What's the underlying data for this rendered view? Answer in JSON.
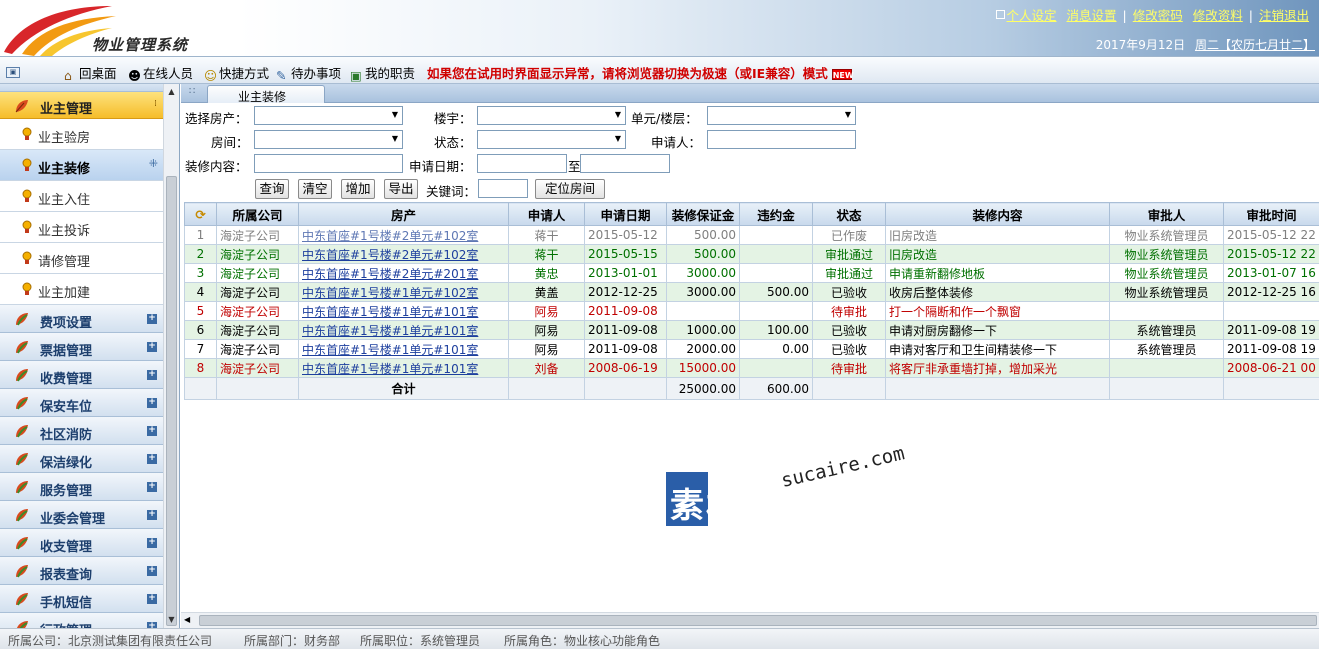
{
  "header": {
    "logo_text": "物业管理系统",
    "links": [
      "个人设定",
      "消息设置",
      "修改密码",
      "修改资料",
      "注销退出"
    ],
    "date": "2017年9月12日",
    "weekday_lunar": "周二【农历七月廿二】"
  },
  "toolbar": {
    "items": [
      "回桌面",
      "在线人员",
      "快捷方式",
      "待办事项",
      "我的职责"
    ],
    "warning": "如果您在试用时界面显示异常，请将浏览器切换为极速（或IE兼容）模式"
  },
  "sidebar": {
    "active_group": "业主管理",
    "sub_items": [
      "业主验房",
      "业主装修",
      "业主入住",
      "业主投诉",
      "请修管理",
      "业主加建"
    ],
    "active_sub": "业主装修",
    "menus": [
      "费项设置",
      "票据管理",
      "收费管理",
      "保安车位",
      "社区消防",
      "保洁绿化",
      "服务管理",
      "业委会管理",
      "收支管理",
      "报表查询",
      "手机短信",
      "行政管理"
    ]
  },
  "tab": {
    "title": "业主装修"
  },
  "filters": {
    "house_label": "选择房产：",
    "building_label": "楼宇：",
    "unit_floor_label": "单元/楼层：",
    "room_label": "房间：",
    "status_label": "状态：",
    "applicant_label": "申请人：",
    "content_label": "装修内容：",
    "date_label": "申请日期：",
    "date_to": "至",
    "keyword_label": "关键词："
  },
  "buttons": {
    "query": "查询",
    "clear": "清空",
    "add": "增加",
    "export": "导出",
    "locate": "定位房间"
  },
  "table": {
    "columns": [
      "所属公司",
      "房产",
      "申请人",
      "申请日期",
      "装修保证金",
      "违约金",
      "状态",
      "装修内容",
      "审批人",
      "审批时间"
    ],
    "rows": [
      {
        "no": "1",
        "company": "海淀子公司",
        "property": "中东首座#1号楼#2单元#102室",
        "applicant": "蒋干",
        "date": "2015-05-12",
        "deposit": "500.00",
        "penalty": "",
        "status": "已作废",
        "content": "旧房改造",
        "approver": "物业系统管理员",
        "approve_time": "2015-05-12 22",
        "tone": "s-gray"
      },
      {
        "no": "2",
        "company": "海淀子公司",
        "property": "中东首座#1号楼#2单元#102室",
        "applicant": "蒋干",
        "date": "2015-05-15",
        "deposit": "500.00",
        "penalty": "",
        "status": "审批通过",
        "content": "旧房改造",
        "approver": "物业系统管理员",
        "approve_time": "2015-05-12 22",
        "tone": "s-green"
      },
      {
        "no": "3",
        "company": "海淀子公司",
        "property": "中东首座#1号楼#2单元#201室",
        "applicant": "黄忠",
        "date": "2013-01-01",
        "deposit": "3000.00",
        "penalty": "",
        "status": "审批通过",
        "content": "申请重新翻修地板",
        "approver": "物业系统管理员",
        "approve_time": "2013-01-07 16",
        "tone": "s-green"
      },
      {
        "no": "4",
        "company": "海淀子公司",
        "property": "中东首座#1号楼#1单元#102室",
        "applicant": "黄盖",
        "date": "2012-12-25",
        "deposit": "3000.00",
        "penalty": "500.00",
        "status": "已验收",
        "content": "收房后整体装修",
        "approver": "物业系统管理员",
        "approve_time": "2012-12-25 16",
        "tone": "s-black"
      },
      {
        "no": "5",
        "company": "海淀子公司",
        "property": "中东首座#1号楼#1单元#101室",
        "applicant": "阿易",
        "date": "2011-09-08",
        "deposit": "",
        "penalty": "",
        "status": "待审批",
        "content": "打一个隔断和作一个飘窗",
        "approver": "",
        "approve_time": "",
        "tone": "s-red"
      },
      {
        "no": "6",
        "company": "海淀子公司",
        "property": "中东首座#1号楼#1单元#101室",
        "applicant": "阿易",
        "date": "2011-09-08",
        "deposit": "1000.00",
        "penalty": "100.00",
        "status": "已验收",
        "content": "申请对厨房翻修一下",
        "approver": "系统管理员",
        "approve_time": "2011-09-08 19",
        "tone": "s-black"
      },
      {
        "no": "7",
        "company": "海淀子公司",
        "property": "中东首座#1号楼#1单元#101室",
        "applicant": "阿易",
        "date": "2011-09-08",
        "deposit": "2000.00",
        "penalty": "0.00",
        "status": "已验收",
        "content": "申请对客厅和卫生间精装修一下",
        "approver": "系统管理员",
        "approve_time": "2011-09-08 19",
        "tone": "s-black"
      },
      {
        "no": "8",
        "company": "海淀子公司",
        "property": "中东首座#1号楼#1单元#101室",
        "applicant": "刘备",
        "date": "2008-06-19",
        "deposit": "15000.00",
        "penalty": "",
        "status": "待审批",
        "content": "将客厅非承重墙打掉，增加采光",
        "approver": "",
        "approve_time": "2008-06-21 00",
        "tone": "s-red"
      }
    ],
    "total_label": "合计",
    "total_deposit": "25000.00",
    "total_penalty": "600.00"
  },
  "watermark": {
    "cn": "素材熱",
    "en": "sucaire.com"
  },
  "statusbar": {
    "company": "所属公司：北京测试集团有限责任公司",
    "dept": "所属部门：财务部",
    "position": "所属职位：系统管理员",
    "role": "所属角色：物业核心功能角色"
  }
}
